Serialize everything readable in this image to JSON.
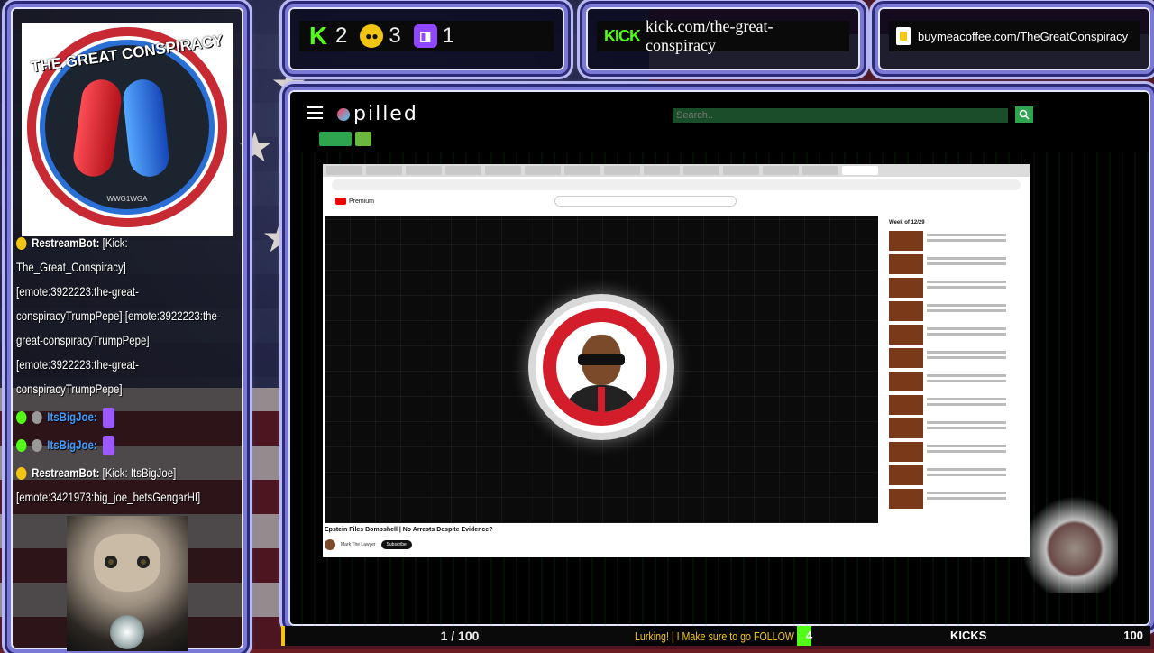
{
  "overlay": {
    "logo": {
      "title": "THE GREAT CONSPIRACY",
      "subtitle": "WWG1WGA"
    },
    "chat": {
      "messages": [
        {
          "user": "RestreamBot:",
          "text": "[Kick: The_Great_Conspiracy] [emote:3922223:the-great-conspiracyTrumpPepe] [emote:3922223:the-great-conspiracyTrumpPepe][emote:3922223:the-great-conspiracyTrumpPepe]"
        },
        {
          "user": "ItsBigJoe:",
          "text": ""
        },
        {
          "user": "ItsBigJoe:",
          "text": ""
        },
        {
          "user": "RestreamBot:",
          "text": "[Kick: ItsBigJoe] [emote:3421973:big_joe_betsGengarHI]"
        }
      ]
    },
    "stats": {
      "kick_count": "2",
      "yellow_count": "3",
      "twitch_count": "1"
    },
    "kick_link": {
      "logo": "KICK",
      "url": "kick.com/the-great-conspiracy"
    },
    "bmc_link": {
      "url": "buymeacoffee.com/TheGreatConspiracy"
    },
    "pilled": {
      "brand": "pilled",
      "search_placeholder": "Search.."
    },
    "browser": {
      "yt_brand": "Premium",
      "video_title": "Epstein Files Bombshell | No Arrests Despite Evidence?",
      "channel": "Mark The Lawyer",
      "subscribe": "Subscribe",
      "side_title": "Week of 12/29"
    },
    "bottom": {
      "progress_text": "1 / 100",
      "ticker": "Lurking! | I Make sure to go FOLLOW",
      "kick_count": "4",
      "kick_label": "KICKS",
      "kick_goal": "100",
      "kick_progress": 0.04
    },
    "colors": {
      "kick_green": "#53fc18",
      "twitch_purple": "#9146ff",
      "accent_yellow": "#f2c513",
      "frame_purple": "#7a79d6"
    }
  }
}
